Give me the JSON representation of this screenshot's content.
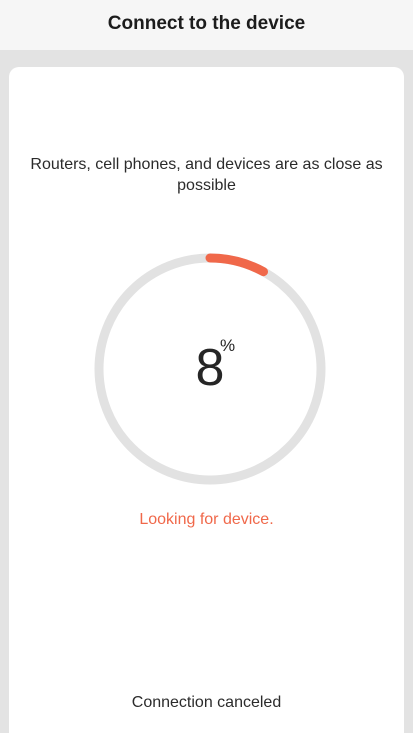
{
  "header": {
    "title": "Connect to the device"
  },
  "main": {
    "hint": "Routers, cell phones, and devices are as close as possible",
    "progress": {
      "value": 8,
      "label": "8",
      "unit": "%"
    },
    "status": "Looking for device.",
    "cancel_label": "Connection canceled"
  },
  "colors": {
    "accent": "#f0684a",
    "track": "#e2e2e2",
    "background": "#e3e3e3",
    "card": "#ffffff"
  }
}
